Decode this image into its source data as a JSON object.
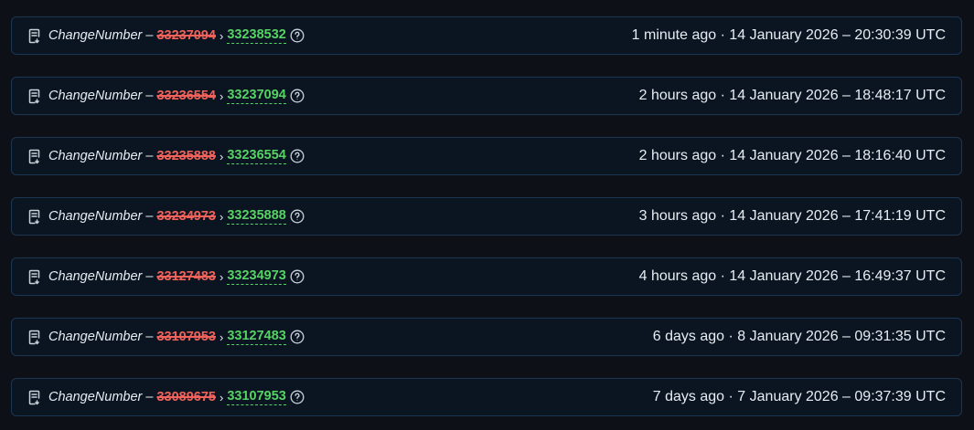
{
  "rows": [
    {
      "key": "ChangeNumber",
      "old": "33237094",
      "new": "33238532",
      "relative": "1 minute ago",
      "absolute": "14 January 2026 – 20:30:39 UTC"
    },
    {
      "key": "ChangeNumber",
      "old": "33236554",
      "new": "33237094",
      "relative": "2 hours ago",
      "absolute": "14 January 2026 – 18:48:17 UTC"
    },
    {
      "key": "ChangeNumber",
      "old": "33235888",
      "new": "33236554",
      "relative": "2 hours ago",
      "absolute": "14 January 2026 – 18:16:40 UTC"
    },
    {
      "key": "ChangeNumber",
      "old": "33234973",
      "new": "33235888",
      "relative": "3 hours ago",
      "absolute": "14 January 2026 – 17:41:19 UTC"
    },
    {
      "key": "ChangeNumber",
      "old": "33127483",
      "new": "33234973",
      "relative": "4 hours ago",
      "absolute": "14 January 2026 – 16:49:37 UTC"
    },
    {
      "key": "ChangeNumber",
      "old": "33107953",
      "new": "33127483",
      "relative": "6 days ago",
      "absolute": "8 January 2026 – 09:31:35 UTC"
    },
    {
      "key": "ChangeNumber",
      "old": "33089675",
      "new": "33107953",
      "relative": "7 days ago",
      "absolute": "7 January 2026 – 09:37:39 UTC"
    }
  ],
  "separators": {
    "dash": "–",
    "arrow": "›",
    "dot": "·"
  },
  "icons": {
    "row_icon": "document-change-icon",
    "help_icon": "help-circle-icon"
  },
  "colors": {
    "old_value": "#f0625a",
    "new_value": "#56d364",
    "row_border": "#1c3550",
    "background": "#0d1117"
  }
}
